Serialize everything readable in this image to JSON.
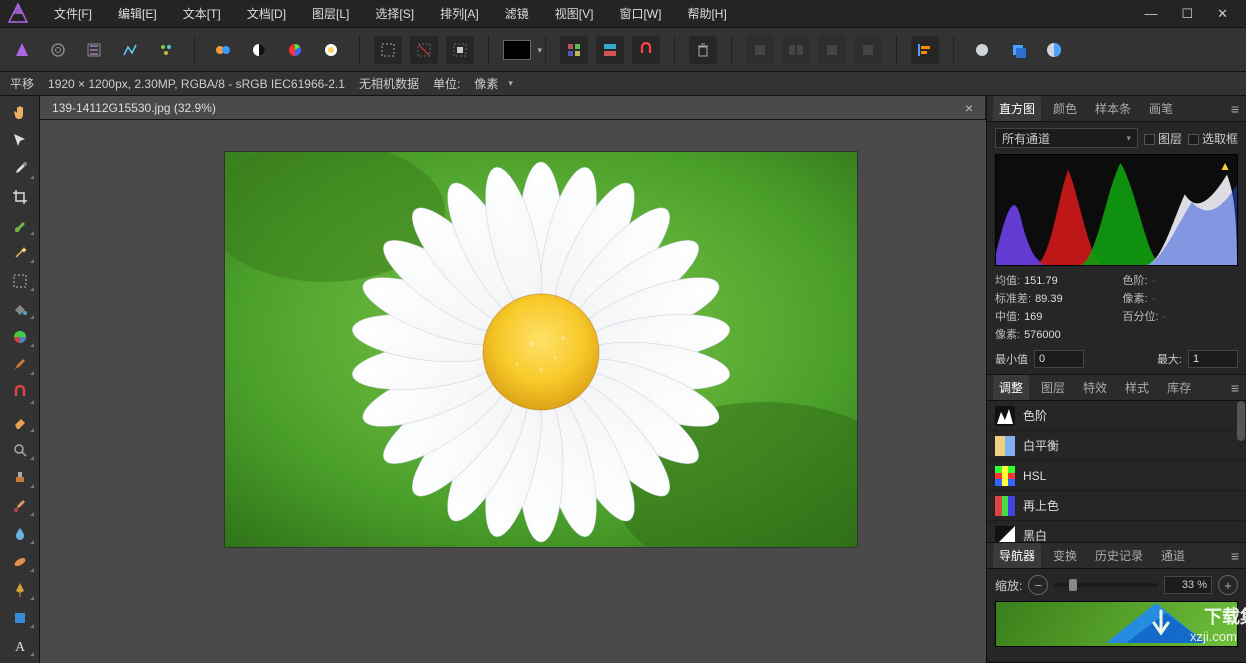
{
  "menu": [
    "文件[F]",
    "编辑[E]",
    "文本[T]",
    "文档[D]",
    "图层[L]",
    "选择[S]",
    "排列[A]",
    "滤镜",
    "视图[V]",
    "窗口[W]",
    "帮助[H]"
  ],
  "contextbar": {
    "tool": "平移",
    "docinfo": "1920 × 1200px, 2.30MP, RGBA/8 - sRGB IEC61966-2.1",
    "camera": "无相机数据",
    "units_label": "单位:",
    "units_value": "像素"
  },
  "document_tab": "139-14112G15530.jpg (32.9%)",
  "panels": {
    "histogram": {
      "tabs": [
        "直方图",
        "颜色",
        "样本条",
        "画笔"
      ],
      "active": 0,
      "channel_select": "所有通道",
      "chk_layer": "图层",
      "chk_selection": "选取框",
      "mean_label": "均值:",
      "mean_value": "151.79",
      "stddev_label": "标准差:",
      "stddev_value": "89.39",
      "median_label": "中值:",
      "median_value": "169",
      "pixels_label": "像素:",
      "pixels_value": "576000",
      "dim_labels": [
        "色阶:",
        "像素:",
        "百分位:"
      ],
      "dim_dash": "-",
      "min_label": "最小值",
      "min_value": "0",
      "max_label": "最大:",
      "max_value": "1"
    },
    "adjustments": {
      "tabs": [
        "调整",
        "图层",
        "特效",
        "样式",
        "库存"
      ],
      "active": 0,
      "items": [
        "色阶",
        "白平衡",
        "HSL",
        "再上色",
        "黑白"
      ]
    },
    "navigator": {
      "tabs": [
        "导航器",
        "变换",
        "历史记录",
        "通道"
      ],
      "active": 0,
      "zoom_label": "缩放:",
      "zoom_value": "33 %"
    }
  },
  "watermark": {
    "text1": "下载集",
    "text2": "xzji.com"
  }
}
